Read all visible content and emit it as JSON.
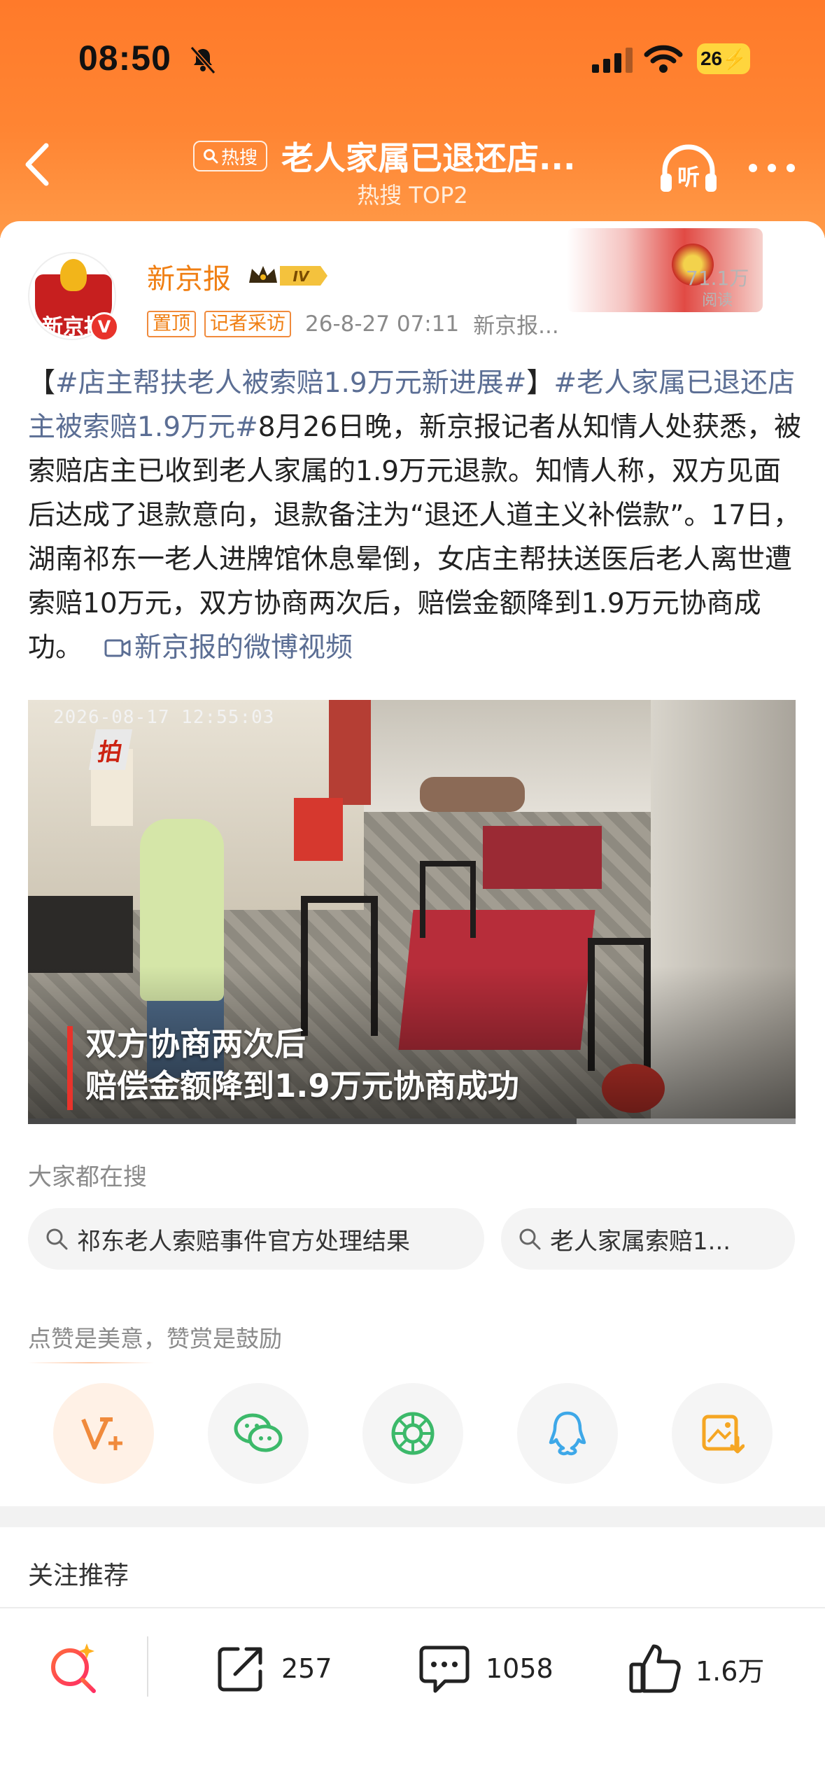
{
  "status_bar": {
    "time": "08:50",
    "battery": "26"
  },
  "nav": {
    "hot_badge": "热搜",
    "title": "老人家属已退还店...",
    "subtitle": "热搜 TOP2",
    "listen_label": "听"
  },
  "post": {
    "author": "新京报",
    "avatar_text": "新京报",
    "verified_mark": "V",
    "level": "IV",
    "tags": [
      "置顶",
      "记者采访"
    ],
    "timestamp": "26-8-27 07:11",
    "source": "新京报...",
    "reads_count": "71.1万",
    "reads_label": "阅读",
    "text_parts": {
      "bracket_open": "【",
      "topic1": "#店主帮扶老人被索赔1.9万元新进展#",
      "bracket_close": "】",
      "topic2": "#老人家属已退还店主被索赔1.9万元#",
      "body": "8月26日晚，新京报记者从知情人处获悉，被索赔店主已收到老人家属的1.9万元退款。知情人称，双方见面后达成了退款意向，退款备注为“退还人道主义补偿款”。17日，湖南祁东一老人进牌馆休息晕倒，女店主帮扶送医后老人离世遭索赔10万元，双方协商两次后，赔偿金额降到1.9万元协商成功。",
      "video_link": "新京报的微博视频"
    }
  },
  "video": {
    "timestamp": "2026-08-17  12:55:03",
    "logo": "拍",
    "caption_line1": "双方协商两次后",
    "caption_line2": "赔偿金额降到1.9万元协商成功",
    "progress": 0.715
  },
  "searching": {
    "title": "大家都在搜",
    "queries": [
      "祁东老人索赔事件官方处理结果",
      "老人家属索赔1..."
    ]
  },
  "appreciate": {
    "text": "点赞是美意，赞赏是鼓励",
    "share_targets": [
      "v-plus-icon",
      "wechat-icon",
      "moments-icon",
      "qq-icon",
      "save-image-icon"
    ]
  },
  "follow_recommend": "关注推荐",
  "bottom_bar": {
    "reposts": "257",
    "comments": "1058",
    "likes": "1.6万"
  },
  "colors": {
    "header_orange": "#ff7a2a",
    "author_orange": "#f07f13",
    "topic_blue": "#5b6e94",
    "caption_red": "#e8332b"
  }
}
